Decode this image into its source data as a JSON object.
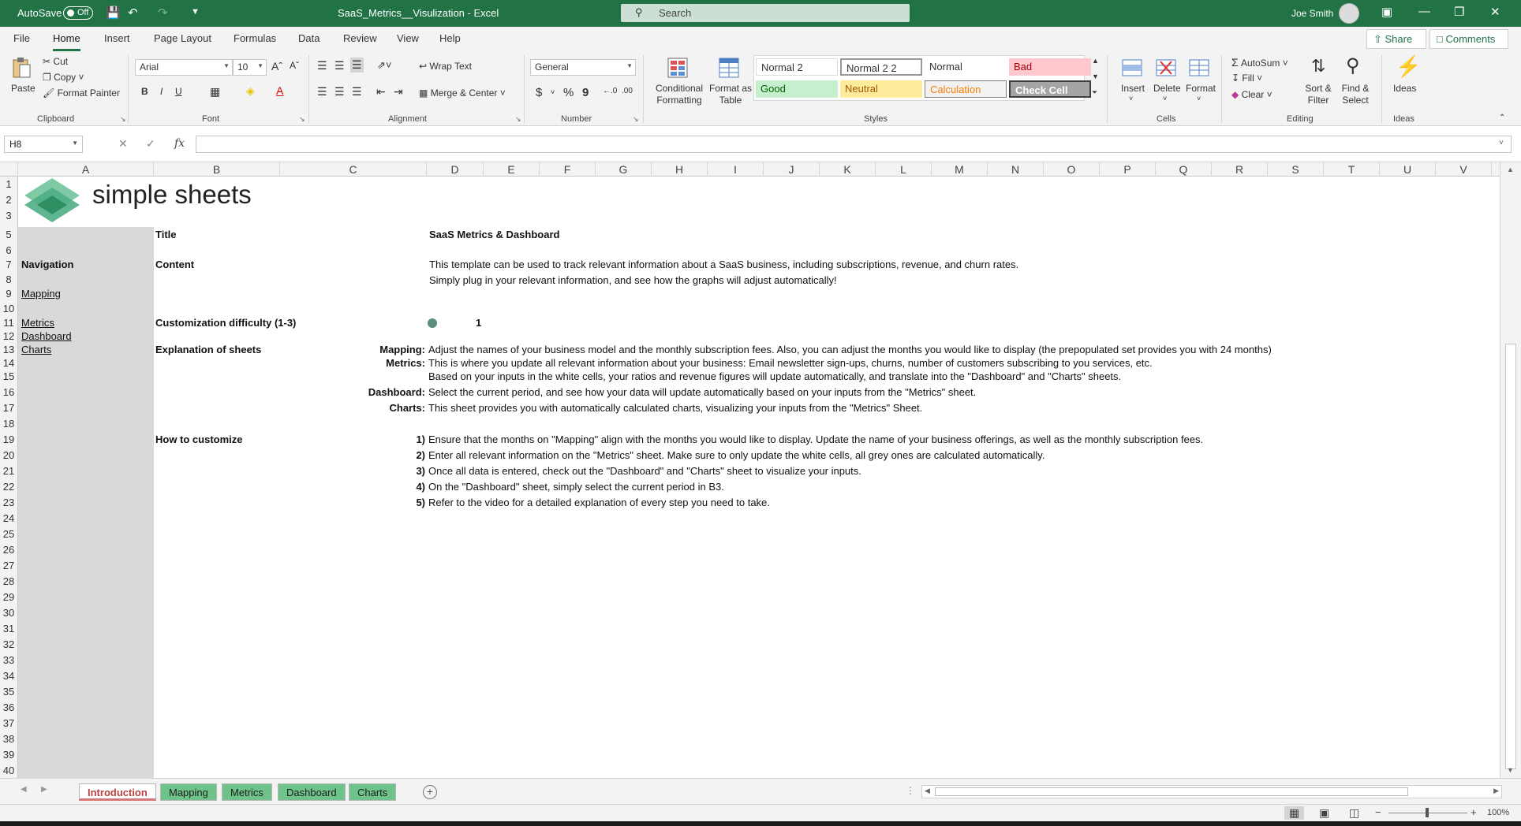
{
  "titlebar": {
    "autosave_label": "AutoSave",
    "autosave_state": "Off",
    "document_title": "SaaS_Metrics__Visulization  -  Excel",
    "search_placeholder": "Search",
    "user_name": "Joe Smith"
  },
  "ribbon_tabs": [
    "File",
    "Home",
    "Insert",
    "Page Layout",
    "Formulas",
    "Data",
    "Review",
    "View",
    "Help"
  ],
  "active_tab": "Home",
  "share_label": "Share",
  "comments_label": "Comments",
  "ribbon": {
    "clipboard": {
      "paste": "Paste",
      "cut": "Cut",
      "copy": "Copy",
      "format_painter": "Format Painter",
      "label": "Clipboard"
    },
    "font": {
      "name": "Arial",
      "size": "10",
      "bold": "B",
      "italic": "I",
      "underline": "U",
      "label": "Font"
    },
    "alignment": {
      "wrap": "Wrap Text",
      "merge": "Merge & Center",
      "label": "Alignment"
    },
    "number": {
      "format": "General",
      "currency": "$",
      "percent": "%",
      "comma": "9",
      "label": "Number"
    },
    "styles": {
      "conditional": "Conditional Formatting",
      "format_table": "Format as Table",
      "cells": [
        "Normal 2",
        "Normal 2 2",
        "Normal",
        "Bad",
        "Good",
        "Neutral",
        "Calculation",
        "Check Cell"
      ],
      "label": "Styles"
    },
    "cells": {
      "insert": "Insert",
      "delete": "Delete",
      "format": "Format",
      "label": "Cells"
    },
    "editing": {
      "autosum": "AutoSum",
      "fill": "Fill",
      "clear": "Clear",
      "sort": "Sort & Filter",
      "find": "Find & Select",
      "label": "Editing"
    },
    "ideas": {
      "ideas": "Ideas",
      "label": "Ideas"
    }
  },
  "formula_bar": {
    "name_box": "H8",
    "fx": "fx",
    "value": ""
  },
  "columns": [
    "A",
    "B",
    "C",
    "D",
    "E",
    "F",
    "G",
    "H",
    "I",
    "J",
    "K",
    "L",
    "M",
    "N",
    "O",
    "P",
    "Q",
    "R",
    "S",
    "T",
    "U",
    "V"
  ],
  "rows": [
    "1",
    "2",
    "3",
    "5",
    "6",
    "7",
    "8",
    "9",
    "10",
    "11",
    "12",
    "13",
    "14",
    "15",
    "16",
    "17",
    "18",
    "19",
    "20",
    "21",
    "22",
    "23",
    "24",
    "25",
    "26",
    "27",
    "28",
    "29",
    "30",
    "31",
    "32",
    "33",
    "34",
    "35",
    "36",
    "37",
    "38",
    "39",
    "40"
  ],
  "logo_text": "simple sheets",
  "sheet": {
    "title_label": "Title",
    "title_value": "SaaS Metrics & Dashboard",
    "navigation_label": "Navigation",
    "nav_links": [
      "Mapping",
      "Metrics",
      "Dashboard",
      "Charts"
    ],
    "content_label": "Content",
    "content_lines": [
      "This template can be used to track relevant information about a SaaS business, including subscriptions, revenue, and churn rates.",
      "Simply plug in your relevant information, and see how the graphs will adjust automatically!"
    ],
    "difficulty_label": "Customization difficulty (1-3)",
    "difficulty_value": "1",
    "explanation_label": "Explanation of sheets",
    "explanations": [
      {
        "key": "Mapping:",
        "text": "Adjust the names of your business model and the monthly subscription fees. Also, you can adjust the months you would like to display (the prepopulated set provides you with 24 months)"
      },
      {
        "key": "Metrics:",
        "text": "This is where you update all relevant information about your business: Email newsletter sign-ups, churns, number of customers subscribing to you services, etc."
      },
      {
        "key": "",
        "text": "Based on your inputs in the white cells, your ratios and revenue figures will update automatically, and translate into the \"Dashboard\" and \"Charts\" sheets."
      },
      {
        "key": "Dashboard:",
        "text": "Select the current period, and see how your data will update automatically based on your inputs from the \"Metrics\" sheet."
      },
      {
        "key": "Charts:",
        "text": "This sheet provides you with automatically calculated charts, visualizing your inputs from the \"Metrics\" Sheet."
      }
    ],
    "howto_label": "How to customize",
    "steps": [
      {
        "num": "1)",
        "text": "Ensure that the months on \"Mapping\" align with the months you would like to display. Update the name of your business offerings, as well as the monthly subscription fees."
      },
      {
        "num": "2)",
        "text": "Enter all relevant information on the \"Metrics\" sheet. Make sure to only update the white cells, all grey ones are calculated automatically."
      },
      {
        "num": "3)",
        "text": "Once all data is entered, check out the \"Dashboard\" and \"Charts\" sheet to visualize your inputs."
      },
      {
        "num": "4)",
        "text": "On the \"Dashboard\" sheet, simply select the current period in B3."
      },
      {
        "num": "5)",
        "text": "Refer to the video for a detailed explanation of every step you need to take."
      }
    ]
  },
  "sheet_tabs": [
    "Introduction",
    "Mapping",
    "Metrics",
    "Dashboard",
    "Charts"
  ],
  "active_sheet": "Introduction",
  "zoom": "100%",
  "colors": {
    "excel_green": "#217346",
    "tab_green": "#6ec38a",
    "grey_column": "#d9d9d9",
    "active_tab_text": "#b64242"
  }
}
